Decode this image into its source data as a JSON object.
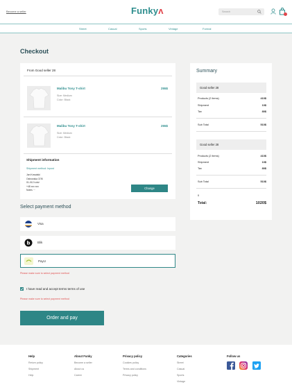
{
  "header": {
    "seller_link": "Become a seller",
    "logo": "Funky",
    "logo_accent": "ʌ",
    "search_placeholder": "Search"
  },
  "nav": [
    "Street",
    "Casual",
    "Sports",
    "Vintage",
    "Formal"
  ],
  "page_title": "Checkout",
  "order": {
    "seller": "From Good seller 28",
    "items": [
      {
        "name": "Malibu Tony T-shirt",
        "size": "Size: Medium",
        "color": "Color: Black",
        "price": "255$"
      },
      {
        "name": "Malibu Tony T-shirt",
        "size": "Size: Medium",
        "color": "Color: Black",
        "price": "255$"
      }
    ],
    "shipment": {
      "title": "Shipment information",
      "method": "Shipment method: Inpost",
      "lines": [
        "Jan Kowalski",
        "Ostrowska 37/8",
        "01-012 Łódź",
        "+48 xxx xxx",
        "Notes ···"
      ],
      "change_label": "Change"
    }
  },
  "payment": {
    "title": "Select payment method",
    "methods": [
      {
        "label": "Visa"
      },
      {
        "label": "Blik"
      },
      {
        "label": "PayU"
      }
    ],
    "error": "Please make sure to select payment method",
    "terms": "I have read and accept terms terms of use",
    "terms_error": "Please make sure to select payment method",
    "order_button": "Order and pay"
  },
  "summary": {
    "title": "Summary",
    "groups": [
      {
        "seller": "Good seller 28",
        "rows": [
          {
            "l": "Products (2 items)",
            "v": "410$"
          },
          {
            "l": "Shipment",
            "v": "10$"
          },
          {
            "l": "Tax",
            "v": "80$"
          }
        ],
        "sub_label": "Sub Total",
        "sub_value": "510$"
      },
      {
        "seller": "Good seller 28",
        "rows": [
          {
            "l": "Products (2 items)",
            "v": "410$"
          },
          {
            "l": "Shipment",
            "v": "10$"
          },
          {
            "l": "Tax",
            "v": "80$"
          }
        ],
        "sub_label": "Sub Total",
        "sub_value": "510$"
      }
    ],
    "zero": "0",
    "total_label": "Total:",
    "total_value": "1020$"
  },
  "footer": {
    "cols": [
      {
        "title": "Help",
        "links": [
          "Return policy",
          "Shipment",
          "Help"
        ]
      },
      {
        "title": "About Funky",
        "links": [
          "Become a seller",
          "About us",
          "Career"
        ]
      },
      {
        "title": "Privacy policy",
        "links": [
          "Cookies policy",
          "Terms and conditions",
          "Privacy policy"
        ]
      },
      {
        "title": "Categories",
        "links": [
          "Street",
          "Casual",
          "Sports",
          "Vintage"
        ]
      },
      {
        "title": "Follow us",
        "links": []
      }
    ]
  },
  "colors": {
    "brand": "#2e8e8e",
    "accent": "#e0454b",
    "button": "#2e8686",
    "error": "#e05050"
  }
}
